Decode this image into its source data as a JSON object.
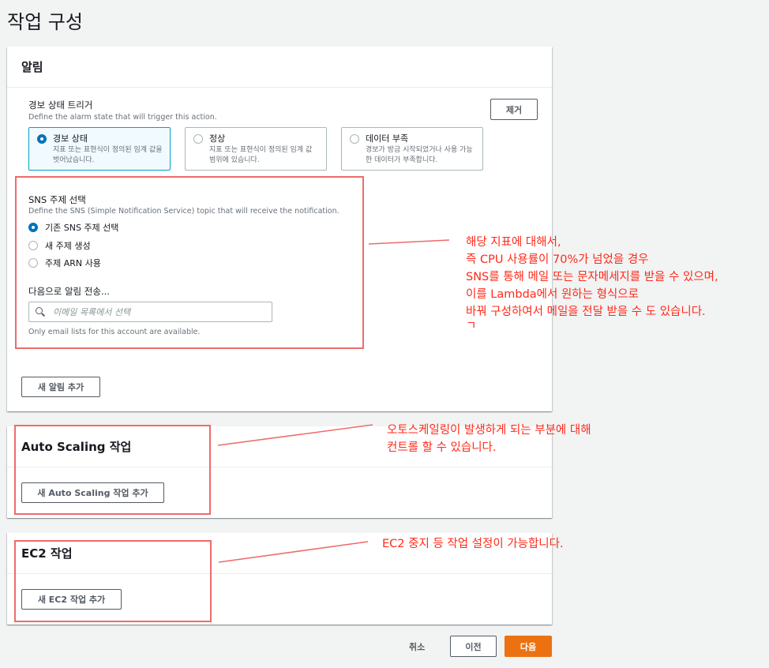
{
  "page": {
    "title": "작업 구성"
  },
  "alarm": {
    "header": "알림",
    "remove_label": "제거",
    "state_trigger": {
      "label": "경보 상태 트리거",
      "description": "Define the alarm state that will trigger this action.",
      "options": [
        {
          "title": "경보 상태",
          "desc": "지표 또는 표현식이 정의된 임계 값을 벗어났습니다.",
          "selected": true
        },
        {
          "title": "정상",
          "desc": "지표 또는 표현식이 정의된 임계 값 범위에 있습니다.",
          "selected": false
        },
        {
          "title": "데이터 부족",
          "desc": "경보가 방금 시작되었거나 사용 가능한 데이터가 부족합니다.",
          "selected": false
        }
      ]
    },
    "sns": {
      "label": "SNS 주제 선택",
      "description": "Define the SNS (Simple Notification Service) topic that will receive the notification.",
      "options": [
        {
          "label": "기존 SNS 주제 선택",
          "selected": true
        },
        {
          "label": "새 주제 생성",
          "selected": false
        },
        {
          "label": "주제 ARN 사용",
          "selected": false
        }
      ],
      "send_to_label": "다음으로 알림 전송...",
      "search_placeholder": "이메일 목록에서 선택",
      "search_note": "Only email lists for this account are available."
    },
    "add_label": "새 알림 추가"
  },
  "autoscaling": {
    "header": "Auto Scaling 작업",
    "add_label": "새 Auto Scaling 작업 추가"
  },
  "ec2": {
    "header": "EC2 작업",
    "add_label": "새 EC2 작업 추가"
  },
  "footer": {
    "cancel": "취소",
    "previous": "이전",
    "next": "다음"
  },
  "annotations": {
    "sns_note": [
      "해당 지표에 대해서,",
      "즉 CPU 사용률이 70%가 넘었을 경우",
      "SNS를 통해 메일 또는 문자메세지를 받을 수 있으며,",
      "이를 Lambda에서 원하는 형식으로",
      "바꿔 구성하여서 메일을 전달 받을 수 도 있습니다.",
      "ㄱ"
    ],
    "autoscaling_note": [
      "오토스케일링이 발생하게 되는 부분에 대해",
      "컨트롤 할 수 있습니다."
    ],
    "ec2_note": [
      "EC2 중지 등 작업 설정이 가능합니다."
    ]
  },
  "colors": {
    "accent": "#0073bb",
    "primary_button": "#ec7211",
    "annotation": "#ff2a1a",
    "annotation_box": "#ee6b6b"
  }
}
